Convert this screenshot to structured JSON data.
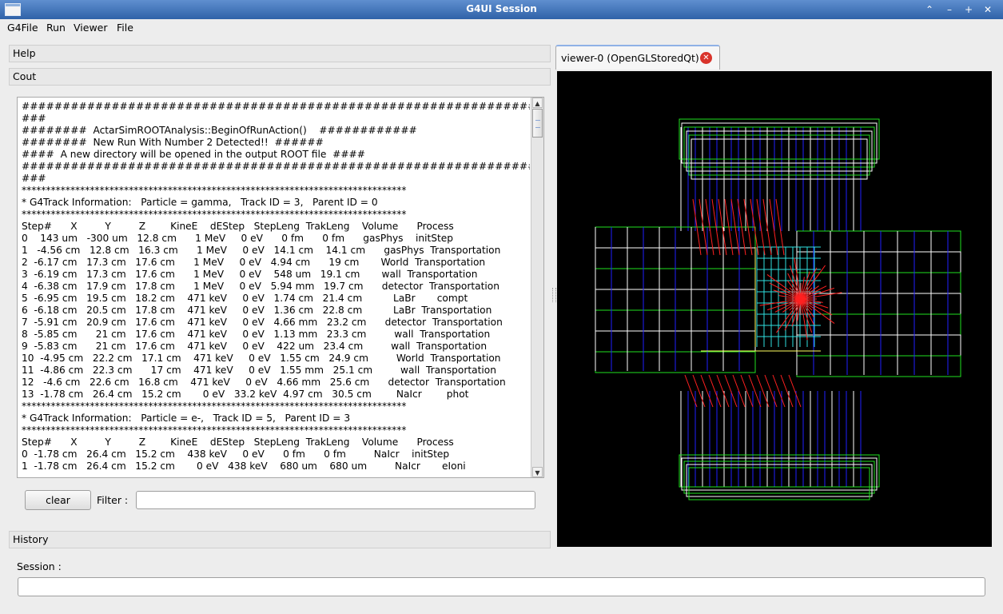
{
  "window": {
    "title": "G4UI Session"
  },
  "menubar": {
    "items": [
      "G4File",
      "Run",
      "Viewer",
      "File"
    ]
  },
  "docks": {
    "help": "Help",
    "cout": "Cout",
    "history": "History"
  },
  "cout": {
    "lines": [
      "########################################################################",
      "###",
      "########  ActarSimROOTAnalysis::BeginOfRunAction()    ############",
      "########  New Run With Number 2 Detected!!  ######",
      "####  A new directory will be opened in the output ROOT file  ####",
      "########################################################################",
      "###",
      "*******************************************************************************",
      "* G4Track Information:   Particle = gamma,   Track ID = 3,   Parent ID = 0",
      "*******************************************************************************",
      "Step#      X         Y         Z        KineE    dEStep   StepLeng  TrakLeng    Volume      Process",
      "0    143 um   -300 um   12.8 cm      1 MeV     0 eV      0 fm      0 fm      gasPhys    initStep",
      "1   -4.56 cm   12.8 cm   16.3 cm      1 MeV     0 eV   14.1 cm    14.1 cm      gasPhys  Transportation",
      "2  -6.17 cm   17.3 cm   17.6 cm      1 MeV     0 eV   4.94 cm      19 cm       World  Transportation",
      "3  -6.19 cm   17.3 cm   17.6 cm      1 MeV     0 eV    548 um   19.1 cm       wall  Transportation",
      "4  -6.38 cm   17.9 cm   17.8 cm      1 MeV     0 eV   5.94 mm   19.7 cm      detector  Transportation",
      "5  -6.95 cm   19.5 cm   18.2 cm    471 keV     0 eV   1.74 cm   21.4 cm          LaBr       compt",
      "6  -6.18 cm   20.5 cm   17.8 cm    471 keV     0 eV   1.36 cm   22.8 cm          LaBr  Transportation",
      "7  -5.91 cm   20.9 cm   17.6 cm    471 keV     0 eV   4.66 mm   23.2 cm      detector  Transportation",
      "8  -5.85 cm      21 cm   17.6 cm    471 keV     0 eV   1.13 mm   23.3 cm         wall  Transportation",
      "9  -5.83 cm      21 cm   17.6 cm    471 keV     0 eV    422 um   23.4 cm         wall  Transportation",
      "10  -4.95 cm   22.2 cm   17.1 cm    471 keV     0 eV   1.55 cm   24.9 cm         World  Transportation",
      "11  -4.86 cm   22.3 cm      17 cm    471 keV     0 eV   1.55 mm   25.1 cm         wall  Transportation",
      "12   -4.6 cm   22.6 cm   16.8 cm    471 keV     0 eV   4.66 mm   25.6 cm      detector  Transportation",
      "13  -1.78 cm   26.4 cm   15.2 cm       0 eV   33.2 keV  4.97 cm   30.5 cm        NaIcr        phot",
      "*******************************************************************************",
      "* G4Track Information:   Particle = e-,   Track ID = 5,   Parent ID = 3",
      "*******************************************************************************",
      "Step#      X         Y         Z        KineE    dEStep   StepLeng  TrakLeng    Volume      Process",
      "0  -1.78 cm   26.4 cm   15.2 cm    438 keV     0 eV      0 fm      0 fm         NaIcr    initStep",
      "1  -1.78 cm   26.4 cm   15.2 cm       0 eV   438 keV    680 um    680 um         NaIcr       eIoni"
    ]
  },
  "controls": {
    "clear_label": "clear",
    "filter_label": "Filter :",
    "filter_value": ""
  },
  "viewer": {
    "tab_label": "viewer-0 (OpenGLStoredQt)"
  },
  "session": {
    "label": "Session :",
    "value": ""
  }
}
